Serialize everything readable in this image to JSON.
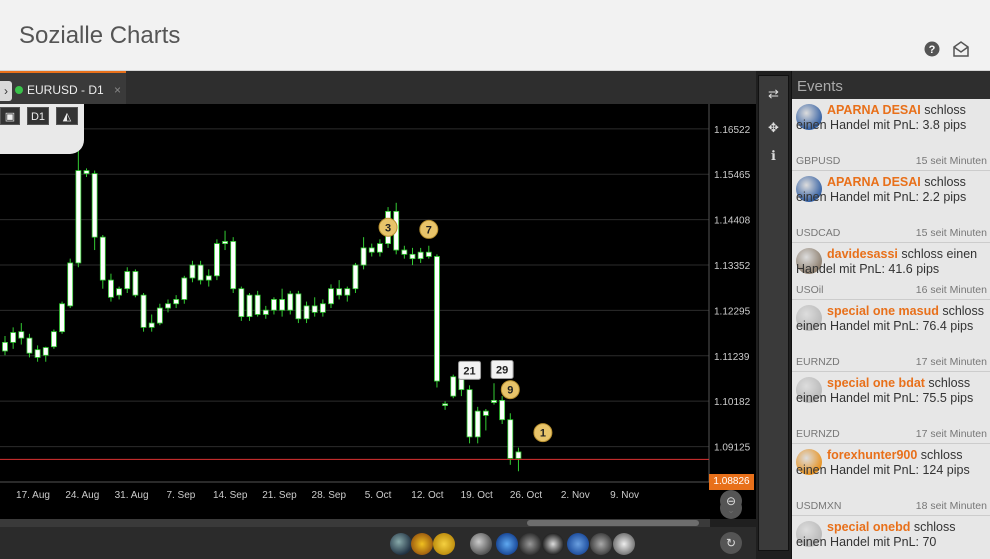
{
  "app": {
    "title": "Sozialle Charts"
  },
  "tab": {
    "label": "EURUSD - D1",
    "close": "×",
    "expand": "›"
  },
  "toolbar": {
    "timeframe": "D1",
    "camera": "▣",
    "chart_type": "◭"
  },
  "chart_data": {
    "type": "candlestick",
    "symbol": "EURUSD",
    "timeframe": "D1",
    "y_ticks": [
      "1.16522",
      "1.15465",
      "1.14408",
      "1.13352",
      "1.12295",
      "1.11239",
      "1.10182",
      "1.09125"
    ],
    "x_ticks": [
      "17. Aug",
      "24. Aug",
      "31. Aug",
      "7. Sep",
      "14. Sep",
      "21. Sep",
      "28. Sep",
      "5. Oct",
      "12. Oct",
      "19. Oct",
      "26. Oct",
      "2. Nov",
      "9. Nov"
    ],
    "current_price": "1.08826",
    "ylim": [
      1.083,
      1.171
    ],
    "candles": [
      {
        "o": 1.1135,
        "h": 1.117,
        "l": 1.1125,
        "c": 1.1155
      },
      {
        "o": 1.1155,
        "h": 1.119,
        "l": 1.114,
        "c": 1.1178
      },
      {
        "o": 1.118,
        "h": 1.12,
        "l": 1.115,
        "c": 1.1165
      },
      {
        "o": 1.1165,
        "h": 1.1175,
        "l": 1.112,
        "c": 1.113
      },
      {
        "o": 1.1138,
        "h": 1.1148,
        "l": 1.111,
        "c": 1.112
      },
      {
        "o": 1.1125,
        "h": 1.1145,
        "l": 1.111,
        "c": 1.1143
      },
      {
        "o": 1.1145,
        "h": 1.1185,
        "l": 1.114,
        "c": 1.118
      },
      {
        "o": 1.118,
        "h": 1.125,
        "l": 1.1175,
        "c": 1.1245
      },
      {
        "o": 1.124,
        "h": 1.135,
        "l": 1.1235,
        "c": 1.134
      },
      {
        "o": 1.134,
        "h": 1.1635,
        "l": 1.133,
        "c": 1.1555
      },
      {
        "o": 1.1555,
        "h": 1.156,
        "l": 1.154,
        "c": 1.1548
      },
      {
        "o": 1.1548,
        "h": 1.1555,
        "l": 1.137,
        "c": 1.14
      },
      {
        "o": 1.14,
        "h": 1.1405,
        "l": 1.128,
        "c": 1.13
      },
      {
        "o": 1.13,
        "h": 1.1315,
        "l": 1.125,
        "c": 1.126
      },
      {
        "o": 1.1265,
        "h": 1.1285,
        "l": 1.1255,
        "c": 1.128
      },
      {
        "o": 1.128,
        "h": 1.133,
        "l": 1.127,
        "c": 1.132
      },
      {
        "o": 1.132,
        "h": 1.1325,
        "l": 1.126,
        "c": 1.1265
      },
      {
        "o": 1.1265,
        "h": 1.127,
        "l": 1.118,
        "c": 1.119
      },
      {
        "o": 1.119,
        "h": 1.122,
        "l": 1.118,
        "c": 1.12
      },
      {
        "o": 1.12,
        "h": 1.1245,
        "l": 1.1195,
        "c": 1.1235
      },
      {
        "o": 1.1235,
        "h": 1.1255,
        "l": 1.1225,
        "c": 1.1245
      },
      {
        "o": 1.1245,
        "h": 1.1265,
        "l": 1.1235,
        "c": 1.1255
      },
      {
        "o": 1.1255,
        "h": 1.131,
        "l": 1.1245,
        "c": 1.1305
      },
      {
        "o": 1.1305,
        "h": 1.1345,
        "l": 1.1295,
        "c": 1.1335
      },
      {
        "o": 1.1335,
        "h": 1.1345,
        "l": 1.129,
        "c": 1.13
      },
      {
        "o": 1.13,
        "h": 1.1325,
        "l": 1.1285,
        "c": 1.131
      },
      {
        "o": 1.131,
        "h": 1.1395,
        "l": 1.13,
        "c": 1.1385
      },
      {
        "o": 1.1385,
        "h": 1.1415,
        "l": 1.137,
        "c": 1.139
      },
      {
        "o": 1.139,
        "h": 1.14,
        "l": 1.127,
        "c": 1.128
      },
      {
        "o": 1.128,
        "h": 1.1285,
        "l": 1.1205,
        "c": 1.1215
      },
      {
        "o": 1.1215,
        "h": 1.127,
        "l": 1.1205,
        "c": 1.1265
      },
      {
        "o": 1.1265,
        "h": 1.1275,
        "l": 1.1215,
        "c": 1.122
      },
      {
        "o": 1.122,
        "h": 1.124,
        "l": 1.121,
        "c": 1.123
      },
      {
        "o": 1.123,
        "h": 1.126,
        "l": 1.122,
        "c": 1.1255
      },
      {
        "o": 1.1255,
        "h": 1.128,
        "l": 1.1215,
        "c": 1.123
      },
      {
        "o": 1.123,
        "h": 1.1275,
        "l": 1.122,
        "c": 1.1268
      },
      {
        "o": 1.1268,
        "h": 1.1275,
        "l": 1.12,
        "c": 1.121
      },
      {
        "o": 1.121,
        "h": 1.125,
        "l": 1.12,
        "c": 1.124
      },
      {
        "o": 1.124,
        "h": 1.126,
        "l": 1.1215,
        "c": 1.1225
      },
      {
        "o": 1.1225,
        "h": 1.1255,
        "l": 1.1215,
        "c": 1.1245
      },
      {
        "o": 1.1245,
        "h": 1.129,
        "l": 1.1235,
        "c": 1.128
      },
      {
        "o": 1.128,
        "h": 1.13,
        "l": 1.1255,
        "c": 1.1265
      },
      {
        "o": 1.1265,
        "h": 1.1285,
        "l": 1.125,
        "c": 1.128
      },
      {
        "o": 1.128,
        "h": 1.134,
        "l": 1.127,
        "c": 1.1335
      },
      {
        "o": 1.1335,
        "h": 1.14,
        "l": 1.1325,
        "c": 1.1375
      },
      {
        "o": 1.1375,
        "h": 1.1385,
        "l": 1.1355,
        "c": 1.1365
      },
      {
        "o": 1.1365,
        "h": 1.1395,
        "l": 1.1355,
        "c": 1.1385
      },
      {
        "o": 1.1385,
        "h": 1.147,
        "l": 1.1375,
        "c": 1.146
      },
      {
        "o": 1.146,
        "h": 1.148,
        "l": 1.136,
        "c": 1.137
      },
      {
        "o": 1.137,
        "h": 1.138,
        "l": 1.135,
        "c": 1.136
      },
      {
        "o": 1.136,
        "h": 1.1375,
        "l": 1.1335,
        "c": 1.135
      },
      {
        "o": 1.135,
        "h": 1.1375,
        "l": 1.134,
        "c": 1.1365
      },
      {
        "o": 1.1365,
        "h": 1.138,
        "l": 1.135,
        "c": 1.1355
      },
      {
        "o": 1.1355,
        "h": 1.136,
        "l": 1.105,
        "c": 1.1065
      },
      {
        "o": 1.1008,
        "h": 1.1018,
        "l": 1.0998,
        "c": 1.1012
      },
      {
        "o": 1.103,
        "h": 1.108,
        "l": 1.1025,
        "c": 1.1075
      },
      {
        "o": 1.107,
        "h": 1.109,
        "l": 1.103,
        "c": 1.1045
      },
      {
        "o": 1.1045,
        "h": 1.1055,
        "l": 1.092,
        "c": 1.0935
      },
      {
        "o": 1.0935,
        "h": 1.1005,
        "l": 1.092,
        "c": 1.0995
      },
      {
        "o": 1.0985,
        "h": 1.1,
        "l": 1.095,
        "c": 1.0995
      },
      {
        "o": 1.1015,
        "h": 1.106,
        "l": 1.101,
        "c": 1.102
      },
      {
        "o": 1.102,
        "h": 1.103,
        "l": 1.0965,
        "c": 1.0975
      },
      {
        "o": 1.0975,
        "h": 1.099,
        "l": 1.087,
        "c": 1.0885
      },
      {
        "o": 1.0885,
        "h": 1.091,
        "l": 1.0855,
        "c": 1.09
      }
    ],
    "markers": [
      {
        "label": "3",
        "index": 47,
        "price": 1.1423,
        "style": "gold"
      },
      {
        "label": "7",
        "index": 52,
        "price": 1.1418,
        "style": "gold"
      },
      {
        "label": "21",
        "index": 57,
        "price": 1.109,
        "style": "white"
      },
      {
        "label": "29",
        "index": 61,
        "price": 1.1092,
        "style": "white"
      },
      {
        "label": "9",
        "index": 62,
        "price": 1.1045,
        "style": "gold"
      },
      {
        "label": "1",
        "index": 66,
        "price": 1.0945,
        "style": "gold"
      }
    ]
  },
  "events": {
    "title": "Events",
    "items": [
      {
        "user": "APARNA DESAI",
        "text": " schloss einen Handel mit PnL: 3.8 pips",
        "symbol": "GBPUSD",
        "time": "15 seit Minuten",
        "avatar": "#2c5aa0"
      },
      {
        "user": "APARNA DESAI",
        "text": " schloss einen Handel mit PnL: 2.2 pips",
        "symbol": "USDCAD",
        "time": "15 seit Minuten",
        "avatar": "#2c5aa0"
      },
      {
        "user": "davidesassi",
        "text": " schloss einen Handel mit PnL: 41.6 pips",
        "symbol": "USOil",
        "time": "16 seit Minuten",
        "avatar": "#8a7b6a"
      },
      {
        "user": "special one masud",
        "text": " schloss einen Handel mit PnL: 76.4 pips",
        "symbol": "EURNZD",
        "time": "17 seit Minuten",
        "avatar": "#b8b8b8"
      },
      {
        "user": "special one bdat",
        "text": " schloss einen Handel mit PnL: 75.5 pips",
        "symbol": "EURNZD",
        "time": "17 seit Minuten",
        "avatar": "#b8b8b8"
      },
      {
        "user": "forexhunter900",
        "text": " schloss einen Handel mit PnL: 124 pips",
        "symbol": "USDMXN",
        "time": "18 seit Minuten",
        "avatar": "#e8901a"
      },
      {
        "user": "special onebd",
        "text": " schloss einen Handel mit PnL: 70",
        "symbol": "",
        "time": "",
        "avatar": "#b8b8b8"
      }
    ]
  },
  "colors": {
    "accent": "#e8701a",
    "candle_up": "#ffffff",
    "candle_down": "#ffffff",
    "wick": "#33cc33",
    "price_line": "#d33"
  }
}
